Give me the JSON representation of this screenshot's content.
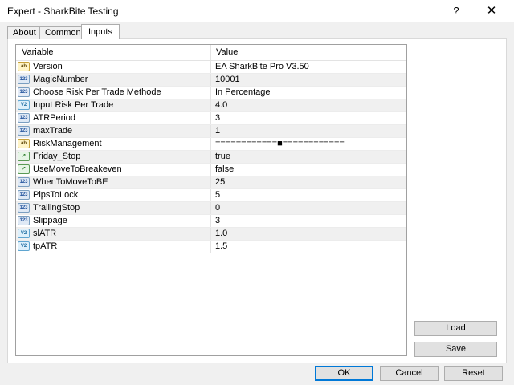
{
  "window": {
    "title": "Expert - SharkBite Testing",
    "help_label": "?",
    "close_label": "✕"
  },
  "tabs": [
    {
      "label": "About"
    },
    {
      "label": "Common"
    },
    {
      "label": "Inputs",
      "active": true
    }
  ],
  "grid": {
    "col_variable": "Variable",
    "col_value": "Value",
    "rows": [
      {
        "icon": "ab",
        "type": "string-icon",
        "name": "Version",
        "value": "EA SharkBite Pro V3.50"
      },
      {
        "icon": "123",
        "type": "integer-icon",
        "name": "MagicNumber",
        "value": "10001"
      },
      {
        "icon": "123",
        "type": "enum-icon",
        "name": "Choose Risk Per Trade Methode",
        "value": "In Percentage"
      },
      {
        "icon": "V2",
        "type": "double-icon",
        "name": "Input Risk Per Trade",
        "value": "4.0"
      },
      {
        "icon": "123",
        "type": "integer-icon",
        "name": "ATRPeriod",
        "value": "3"
      },
      {
        "icon": "123",
        "type": "integer-icon",
        "name": "maxTrade",
        "value": "1"
      },
      {
        "icon": "ab",
        "type": "string-icon",
        "name": "RiskManagement",
        "value": "============■============"
      },
      {
        "icon": "↗",
        "type": "boolean-icon",
        "name": "Friday_Stop",
        "value": "true"
      },
      {
        "icon": "↗",
        "type": "boolean-icon",
        "name": "UseMoveToBreakeven",
        "value": "false"
      },
      {
        "icon": "123",
        "type": "integer-icon",
        "name": "WhenToMoveToBE",
        "value": "25"
      },
      {
        "icon": "123",
        "type": "integer-icon",
        "name": "PipsToLock",
        "value": "5"
      },
      {
        "icon": "123",
        "type": "integer-icon",
        "name": "TrailingStop",
        "value": "0"
      },
      {
        "icon": "123",
        "type": "integer-icon",
        "name": "Slippage",
        "value": "3"
      },
      {
        "icon": "V2",
        "type": "double-icon",
        "name": "slATR",
        "value": "1.0"
      },
      {
        "icon": "V2",
        "type": "double-icon",
        "name": "tpATR",
        "value": "1.5"
      }
    ]
  },
  "buttons": {
    "load": "Load",
    "save": "Save",
    "ok": "OK",
    "cancel": "Cancel",
    "reset": "Reset"
  },
  "colors": {
    "accent": "#0078d7",
    "dialog_bg": "#f0f0f0"
  }
}
